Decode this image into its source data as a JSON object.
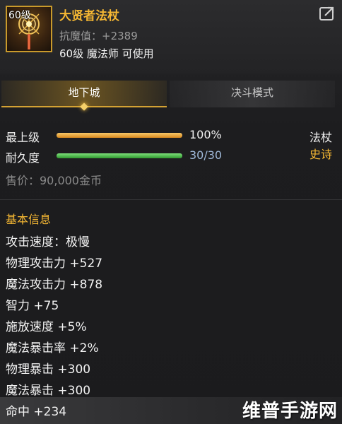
{
  "item": {
    "level_badge": "60级",
    "name": "大贤者法杖",
    "stat": "抗魔值：+2389",
    "requirement": "60级 魔法师 可使用"
  },
  "tabs": [
    {
      "label": "地下城",
      "active": true
    },
    {
      "label": "决斗模式",
      "active": false
    }
  ],
  "stats": {
    "upgrade": {
      "label": "最上级",
      "value_text": "100%",
      "fill": 1.0,
      "color": "#e89a2a"
    },
    "durability": {
      "label": "耐久度",
      "value_text": "30/30",
      "fill": 1.0,
      "color": "#3bb53b"
    }
  },
  "type": {
    "weapon": "法杖",
    "rarity": "史诗",
    "weapon_color": "#f2f2f2",
    "rarity_color": "#f5b733"
  },
  "price": "售价：90,000金币",
  "basic_info": {
    "title": "基本信息",
    "lines": [
      "攻击速度：极慢",
      "物理攻击力 +527",
      "魔法攻击力 +878",
      "智力 +75",
      "施放速度 +5%",
      "魔法暴击率 +2%",
      "物理暴击 +300",
      "魔法暴击 +300"
    ],
    "footer_line": "命中 +234"
  },
  "watermark": "维普手游网",
  "icons": {
    "share": "share-arrow-icon",
    "item": "staff-item-icon"
  }
}
